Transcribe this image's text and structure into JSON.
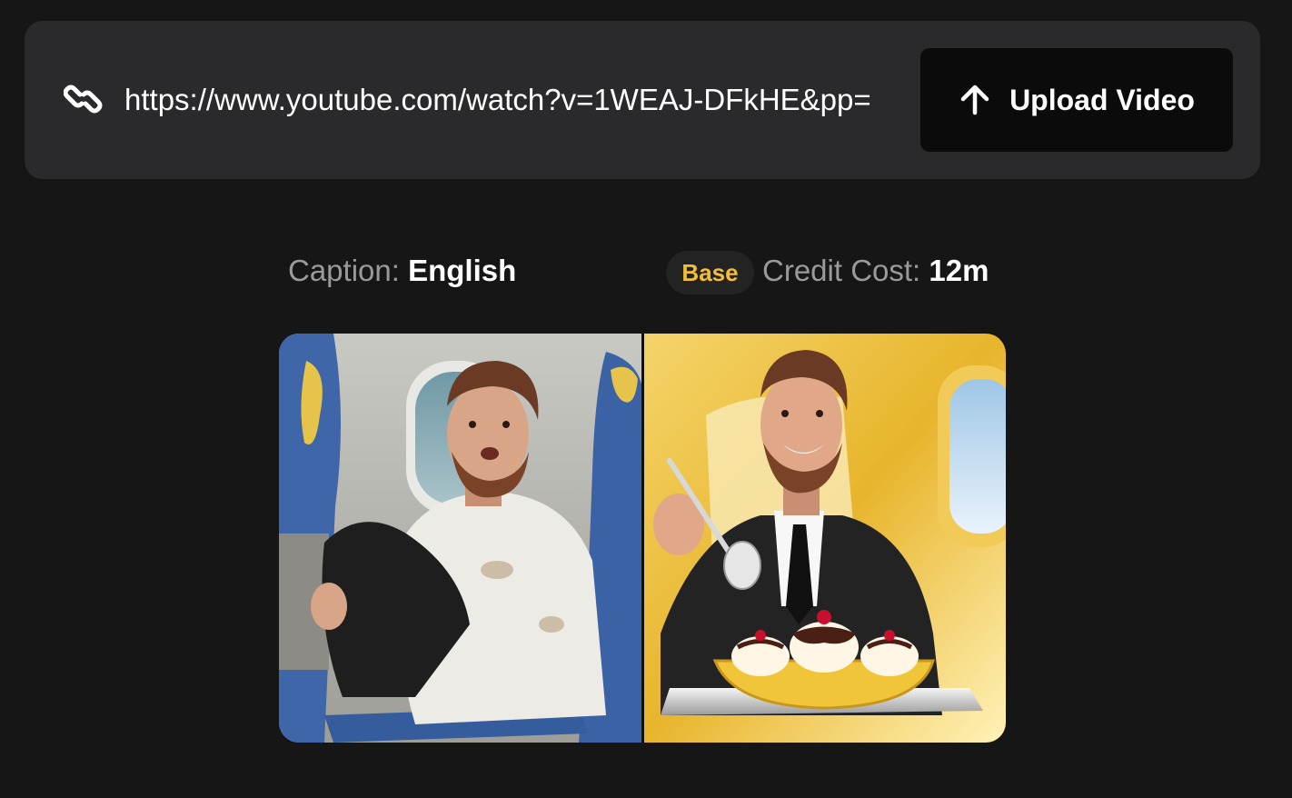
{
  "url_bar": {
    "link_icon": "link-icon",
    "url_value": "https://www.youtube.com/watch?v=1WEAJ-DFkHE&pp=",
    "upload_icon": "arrow-up-icon",
    "upload_label": "Upload Video"
  },
  "caption": {
    "label": "Caption:",
    "value": "English"
  },
  "credit": {
    "tier": "Base",
    "label": "Credit Cost:",
    "value": "12m"
  },
  "colors": {
    "background": "#161616",
    "panel": "#2a2a2c",
    "button": "#0b0b0b",
    "badge_text": "#f2be3a",
    "muted_text": "#9a9a9a"
  }
}
